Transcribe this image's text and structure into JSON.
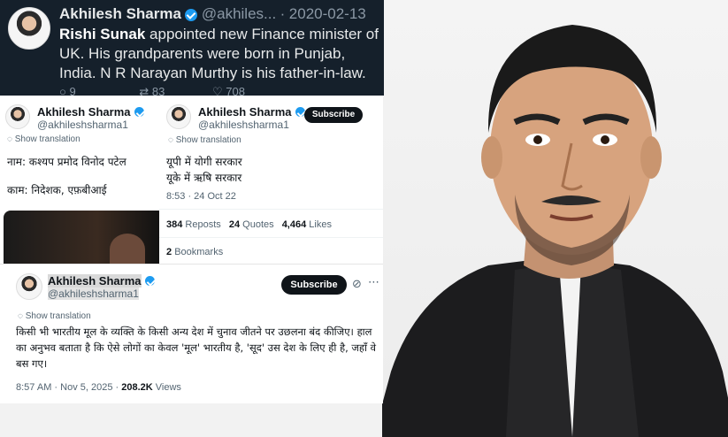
{
  "tweet_top": {
    "name": "Akhilesh Sharma",
    "handle": "@akhiles...",
    "date": "2020-02-13",
    "text_bold": "Rishi Sunak",
    "text_rest": " appointed new Finance minister of UK. His grandparents were born in Punjab, India. N R Narayan Murthy is his father-in-law.",
    "reply_count": "9",
    "retweet_count": "83",
    "like_count": "708"
  },
  "tweet_left": {
    "name": "Akhilesh Sharma",
    "handle": "@akhileshsharma1",
    "show_translation": "Show translation",
    "line1": "नाम: कश्यप प्रमोद विनोद पटेल",
    "line2": "काम: निदेशक, एफ़बीआई"
  },
  "tweet_right": {
    "name": "Akhilesh Sharma",
    "handle": "@akhileshsharma1",
    "subscribe": "Subscribe",
    "show_translation": "Show translation",
    "line1": "यूपी में योगी सरकार",
    "line2": "यूके में ऋषि सरकार",
    "timestamp": "8:53 · 24 Oct 22",
    "reposts_num": "384",
    "reposts_label": "Reposts",
    "quotes_num": "24",
    "quotes_label": "Quotes",
    "likes_num": "4,464",
    "likes_label": "Likes",
    "bookmarks_num": "2",
    "bookmarks_label": "Bookmarks"
  },
  "tweet_bottom": {
    "name": "Akhilesh Sharma",
    "handle": "@akhileshsharma1",
    "subscribe": "Subscribe",
    "show_translation": "Show translation",
    "text": "किसी भी भारतीय मूल के व्यक्ति के किसी अन्य देश में चुनाव जीतने पर उछलना बंद कीजिए। हाल का अनुभव बताता है कि ऐसे लोगों का केवल 'मूल' भारतीय है, 'सूद' उस देश के लिए ही है, जहाँ वे बस गए।",
    "timestamp": "8:57 AM · Nov 5, 2025 ·",
    "views_num": "208.2K",
    "views_label": "Views"
  },
  "colors": {
    "dark_bg": "#15202b",
    "verified": "#1d9bf0",
    "button": "#0f1419"
  }
}
